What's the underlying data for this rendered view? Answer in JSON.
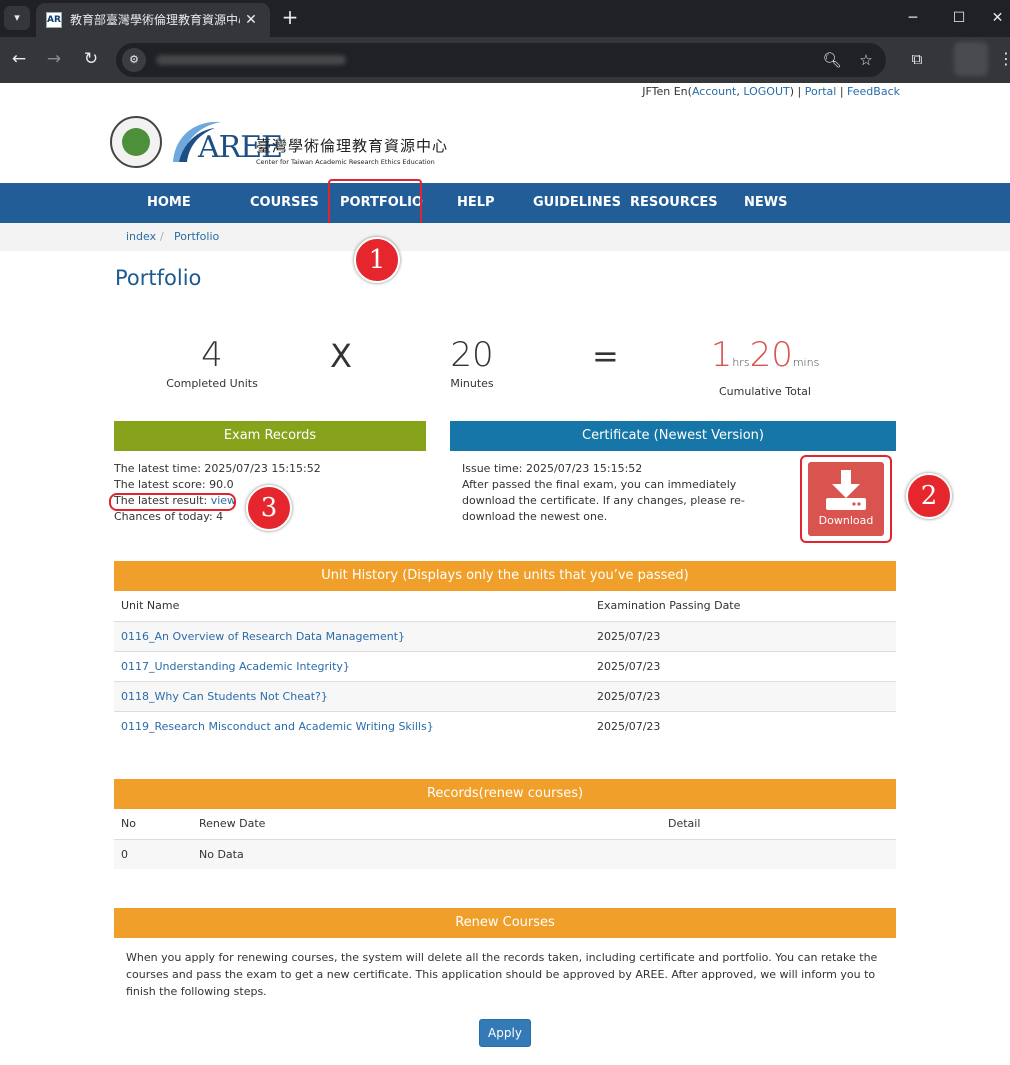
{
  "browser": {
    "tab_title": "教育部臺灣學術倫理教育資源中心",
    "favicon_text": "AR",
    "new_tab": "+",
    "icons": {
      "tab_menu": "chevron-down-icon",
      "back": "arrow-left-icon",
      "forward": "arrow-right-icon",
      "reload": "reload-icon",
      "site_info": "tune-icon",
      "zoom": "magnifier-icon",
      "bookmark": "star-icon",
      "extensions": "puzzle-icon",
      "menu": "kebab-icon"
    }
  },
  "header": {
    "user_name": "JFTen En",
    "account_label": "Account",
    "logout_label": "LOGOUT",
    "portal_label": "Portal",
    "feedback_label": "FeedBack",
    "logo_aree": "AREE",
    "logo_cn": "臺灣學術倫理教育資源中心",
    "logo_en": "Center for Taiwan Academic Research Ethics Education"
  },
  "nav": {
    "items": [
      "HOME",
      "COURSES",
      "PORTFOLIO",
      "HELP",
      "GUIDELINES",
      "RESOURCES",
      "NEWS"
    ]
  },
  "breadcrumb": {
    "items": [
      "index",
      "Portfolio"
    ],
    "separator": "/"
  },
  "page_title": "Portfolio",
  "stats": {
    "units": "4",
    "units_label": "Completed Units",
    "times": "X",
    "minutes": "20",
    "minutes_label": "Minutes",
    "equals": "=",
    "hrs_value": "1",
    "hrs_unit": "hrs",
    "mins_value": "20",
    "mins_unit": "mins",
    "total_label": "Cumulative Total"
  },
  "exam": {
    "heading": "Exam Records",
    "latest_time": "The latest time: 2025/07/23 15:15:52",
    "latest_score": "The latest score: 90.0",
    "latest_result_label": "The latest result: ",
    "latest_result_link": "view",
    "chances": "Chances of today: 4"
  },
  "certificate": {
    "heading": "Certificate (Newest Version)",
    "issue_time": "Issue time: 2025/07/23 15:15:52",
    "desc1": "After passed the final exam, you can immediately",
    "desc2": "download the certificate. If any changes, please re-",
    "desc3": "download the newest one.",
    "download_label": "Download"
  },
  "unit_history": {
    "heading": "Unit History (Displays only the units that you’ve passed)",
    "columns": [
      "Unit Name",
      "Examination Passing Date"
    ],
    "rows": [
      [
        "0116_An Overview of Research Data Management}",
        "2025/07/23"
      ],
      [
        "0117_Understanding Academic Integrity}",
        "2025/07/23"
      ],
      [
        "0118_Why Can Students Not Cheat?}",
        "2025/07/23"
      ],
      [
        "0119_Research Misconduct and Academic Writing Skills}",
        "2025/07/23"
      ]
    ]
  },
  "renew_records": {
    "heading": "Records(renew courses)",
    "columns": [
      "No",
      "Renew Date",
      "Detail"
    ],
    "rows": [
      [
        "0",
        "No Data",
        ""
      ]
    ]
  },
  "renew_courses": {
    "heading": "Renew Courses",
    "text": "When you apply for renewing courses, the system will delete all the records taken, including certificate and portfolio. You can retake the courses and pass the exam to get a new certificate. This application should be approved by AREE. After approved, we will inform you to finish the following steps.",
    "apply_label": "Apply"
  },
  "annotations": [
    "1",
    "2",
    "3"
  ],
  "colors": {
    "nav_bar": "#235d97",
    "exam_header": "#86a31b",
    "certificate_header": "#1776a8",
    "section_header": "#f0a02a",
    "download_button": "#d9534f",
    "apply_button": "#337ab7",
    "annotation_red": "#e5262d"
  }
}
